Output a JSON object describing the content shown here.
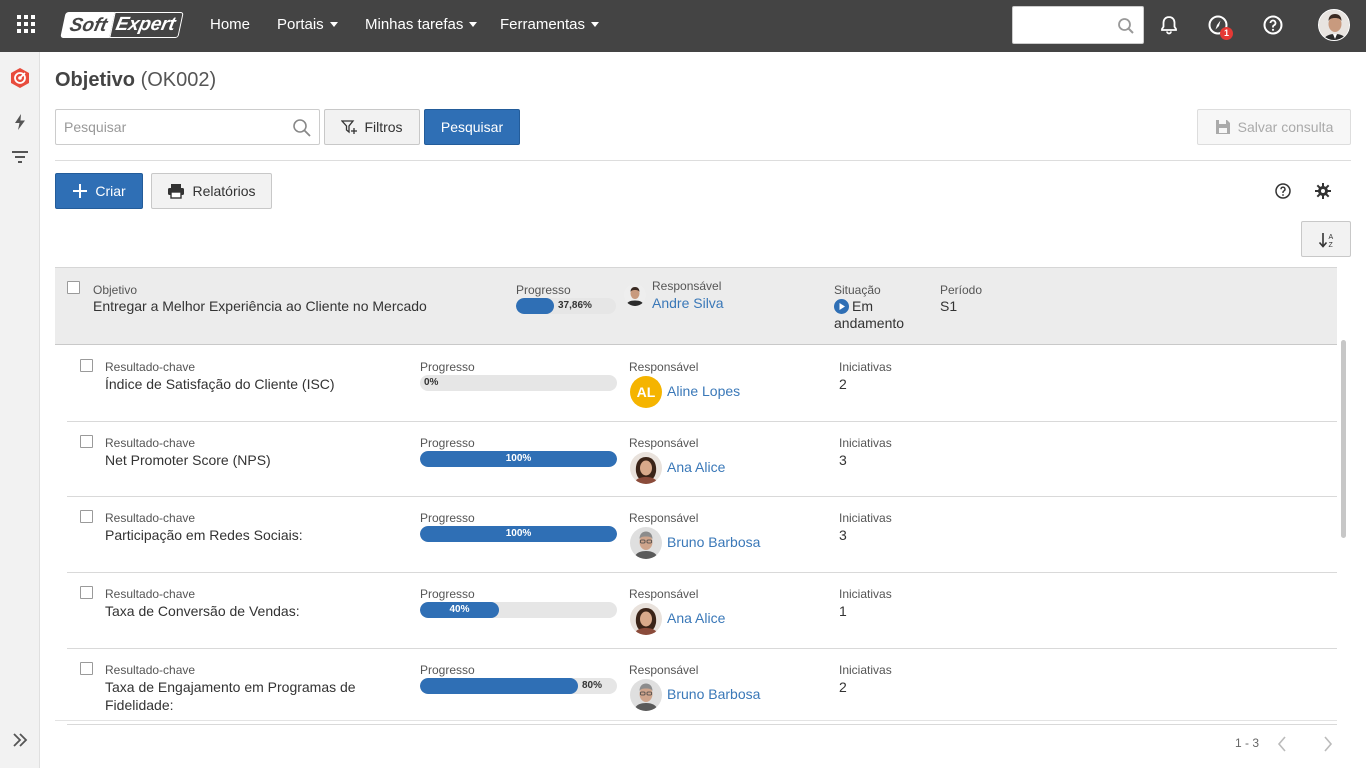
{
  "topbar": {
    "logo_left": "Soft",
    "logo_right": "Expert",
    "nav": [
      {
        "label": "Home"
      },
      {
        "label": "Portais"
      },
      {
        "label": "Minhas tarefas"
      },
      {
        "label": "Ferramentas"
      }
    ],
    "search_value": "",
    "notification_count": "1",
    "icons": [
      "apps-grid-icon",
      "search-icon",
      "bell-icon",
      "compass-icon",
      "help-icon",
      "user-avatar"
    ]
  },
  "leftrail": {
    "icons": [
      "okr-target-icon",
      "lightning-icon",
      "filter-lines-icon",
      "expand-double-chevron-icon"
    ]
  },
  "page": {
    "title": "Objetivo",
    "code": "(OK002)"
  },
  "toolbar": {
    "search_placeholder": "Pesquisar",
    "filters_label": "Filtros",
    "search_button": "Pesquisar",
    "save_query": "Salvar consulta",
    "create_label": "Criar",
    "reports_label": "Relatórios"
  },
  "objective": {
    "type_label": "Objetivo",
    "name": "Entregar a Melhor Experiência ao Cliente no Mercado",
    "progress_label": "Progresso",
    "progress_text": "37,86%",
    "progress": 0.3786,
    "owner_label": "Responsável",
    "owner": "Andre Silva",
    "status_label": "Situação",
    "status_line1": "Em",
    "status_line2": "andamento",
    "period_label": "Período",
    "period": "S1"
  },
  "key_results": [
    {
      "type_label": "Resultado-chave",
      "name_line1": "Índice de Satisfação do Cliente (ISC)",
      "name_line2": "",
      "progress_label": "Progresso",
      "progress_text": "0%",
      "progress": 0.0,
      "owner_label": "Responsável",
      "owner": "Aline Lopes",
      "owner_initials": "AL",
      "initiatives_label": "Iniciativas",
      "initiatives": "2"
    },
    {
      "type_label": "Resultado-chave",
      "name_line1": "Net Promoter Score (NPS)",
      "name_line2": "",
      "progress_label": "Progresso",
      "progress_text": "100%",
      "progress": 1.0,
      "owner_label": "Responsável",
      "owner": "Ana Alice",
      "owner_initials": "",
      "initiatives_label": "Iniciativas",
      "initiatives": "3"
    },
    {
      "type_label": "Resultado-chave",
      "name_line1": "Participação em Redes Sociais:",
      "name_line2": "",
      "progress_label": "Progresso",
      "progress_text": "100%",
      "progress": 1.0,
      "owner_label": "Responsável",
      "owner": "Bruno Barbosa",
      "owner_initials": "",
      "initiatives_label": "Iniciativas",
      "initiatives": "3"
    },
    {
      "type_label": "Resultado-chave",
      "name_line1": "Taxa de Conversão de Vendas:",
      "name_line2": "",
      "progress_label": "Progresso",
      "progress_text": "40%",
      "progress": 0.4,
      "owner_label": "Responsável",
      "owner": "Ana Alice",
      "owner_initials": "",
      "initiatives_label": "Iniciativas",
      "initiatives": "1"
    },
    {
      "type_label": "Resultado-chave",
      "name_line1": "Taxa de Engajamento em Programas de",
      "name_line2": "Fidelidade:",
      "progress_label": "Progresso",
      "progress_text": "80%",
      "progress": 0.8,
      "owner_label": "Responsável",
      "owner": "Bruno Barbosa",
      "owner_initials": "",
      "initiatives_label": "Iniciativas",
      "initiatives": "2"
    }
  ],
  "pager": {
    "range": "1 - 3"
  },
  "colors": {
    "topbar": "#444444",
    "primary": "#2f6fb5",
    "link": "#3a78b8",
    "brand_red": "#e53935"
  }
}
